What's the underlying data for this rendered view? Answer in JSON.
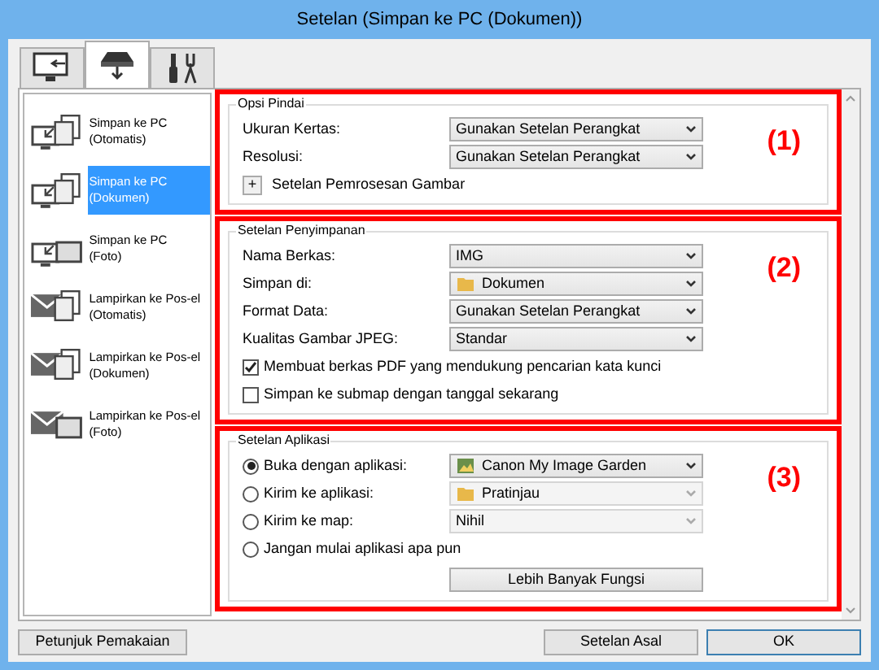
{
  "window": {
    "title": "Setelan (Simpan ke PC (Dokumen))"
  },
  "tabs": [
    {
      "kind": "monitor",
      "selected": false
    },
    {
      "kind": "scanner",
      "selected": true
    },
    {
      "kind": "tools",
      "selected": false
    }
  ],
  "sidebar": {
    "items": [
      {
        "kind": "pc",
        "label": "Simpan ke PC",
        "sublabel": "(Otomatis)",
        "selected": false
      },
      {
        "kind": "pc",
        "label": "Simpan ke PC",
        "sublabel": "(Dokumen)",
        "selected": true
      },
      {
        "kind": "pc-photo",
        "label": "Simpan ke PC",
        "sublabel": "(Foto)",
        "selected": false
      },
      {
        "kind": "mail",
        "label": "Lampirkan ke Pos-el",
        "sublabel": "(Otomatis)",
        "selected": false
      },
      {
        "kind": "mail",
        "label": "Lampirkan ke Pos-el",
        "sublabel": "(Dokumen)",
        "selected": false
      },
      {
        "kind": "mail-photo",
        "label": "Lampirkan ke Pos-el",
        "sublabel": "(Foto)",
        "selected": false
      }
    ]
  },
  "sections": [
    {
      "title": "Opsi Pindai",
      "callout": "(1)",
      "rows": [
        {
          "kind": "select",
          "label": "Ukuran Kertas:",
          "select": {
            "kind": "plain",
            "value": "Gunakan Setelan Perangkat",
            "disabled": false
          }
        },
        {
          "kind": "select",
          "label": "Resolusi:",
          "select": {
            "kind": "plain",
            "value": "Gunakan Setelan Perangkat",
            "disabled": false
          }
        },
        {
          "kind": "expander",
          "label": "Setelan Pemrosesan Gambar",
          "symbol": "+"
        }
      ]
    },
    {
      "title": "Setelan Penyimpanan",
      "callout": "(2)",
      "rows": [
        {
          "kind": "select",
          "label": "Nama Berkas:",
          "select": {
            "kind": "plain",
            "value": "IMG",
            "disabled": false
          }
        },
        {
          "kind": "select",
          "label": "Simpan di:",
          "select": {
            "kind": "folder",
            "value": "Dokumen",
            "disabled": false
          }
        },
        {
          "kind": "select",
          "label": "Format Data:",
          "select": {
            "kind": "plain",
            "value": "Gunakan Setelan Perangkat",
            "disabled": false
          }
        },
        {
          "kind": "select",
          "label": "Kualitas Gambar JPEG:",
          "select": {
            "kind": "plain",
            "value": "Standar",
            "disabled": false
          }
        },
        {
          "kind": "checkbox",
          "label": "Membuat berkas PDF yang mendukung pencarian kata kunci",
          "checked": true
        },
        {
          "kind": "checkbox",
          "label": "Simpan ke submap dengan tanggal sekarang",
          "checked": false
        }
      ]
    },
    {
      "title": "Setelan Aplikasi",
      "callout": "(3)",
      "rows": [
        {
          "kind": "radio",
          "label": "Buka dengan aplikasi:",
          "selected": true,
          "select": {
            "kind": "app",
            "value": "Canon My Image Garden",
            "disabled": false
          }
        },
        {
          "kind": "radio",
          "label": "Kirim ke aplikasi:",
          "selected": false,
          "select": {
            "kind": "folder",
            "value": "Pratinjau",
            "disabled": true
          }
        },
        {
          "kind": "radio",
          "label": "Kirim ke map:",
          "selected": false,
          "select": {
            "kind": "plain",
            "value": "Nihil",
            "disabled": true
          }
        },
        {
          "kind": "radio",
          "label": "Jangan mulai aplikasi apa pun",
          "selected": false
        },
        {
          "kind": "button",
          "label": "Lebih Banyak Fungsi"
        }
      ]
    }
  ],
  "footer": {
    "help_button": "Petunjuk Pemakaian",
    "buttons": [
      "Setelan Asal",
      "OK"
    ]
  }
}
